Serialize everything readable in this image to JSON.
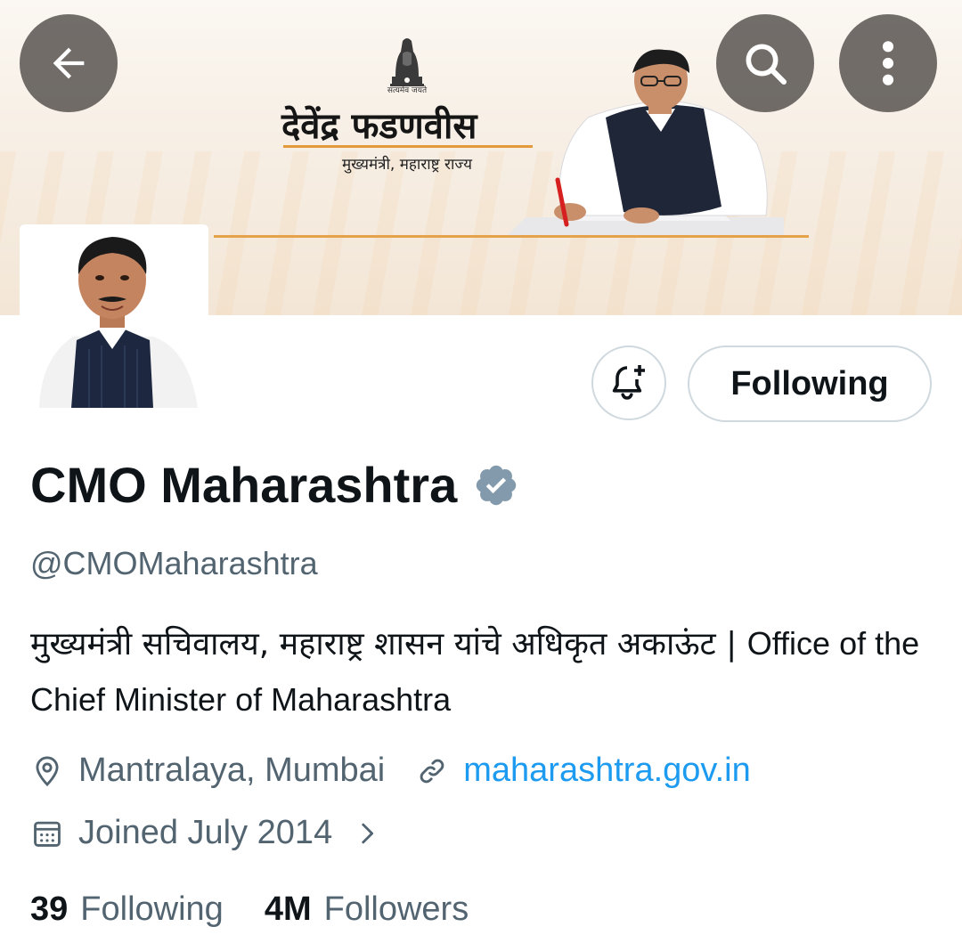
{
  "banner": {
    "emblem_motto": "सत्यमेव जयते",
    "name_marathi": "देवेंद्र फडणवीस",
    "subtitle_marathi": "मुख्यमंत्री, महाराष्ट्र राज्य"
  },
  "header": {
    "back_icon": "arrow-left-icon",
    "search_icon": "search-icon",
    "more_icon": "more-vertical-icon"
  },
  "actions": {
    "notify_icon": "bell-plus-icon",
    "following_label": "Following"
  },
  "profile": {
    "display_name": "CMO Maharashtra",
    "verified_color": "#829aab",
    "handle": "@CMOMaharashtra",
    "bio_marathi": "मुख्यमंत्री सचिवालय, महाराष्ट्र शासन यांचे अधिकृत अकाऊंट | ",
    "bio_english": "Office of the Chief Minister of Maharashtra",
    "location": "Mantralaya, Mumbai",
    "website": "maharashtra.gov.in",
    "joined": "Joined July 2014"
  },
  "stats": {
    "following_count": "39",
    "following_label": "Following",
    "followers_count": "4M",
    "followers_label": "Followers"
  },
  "colors": {
    "link": "#1d9bf0",
    "secondary_text": "#536471",
    "primary_text": "#0f1419",
    "accent_saffron": "#e39a3a"
  }
}
